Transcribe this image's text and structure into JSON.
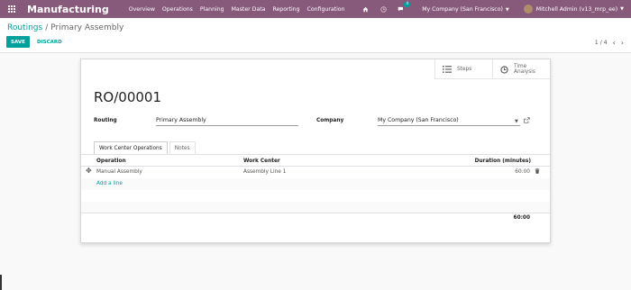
{
  "navbar": {
    "brand": "Manufacturing",
    "menu": [
      "Overview",
      "Operations",
      "Planning",
      "Master Data",
      "Reporting",
      "Configuration"
    ],
    "chat_badge": "4",
    "company": "My Company (San Francisco)",
    "user": "Mitchell Admin (v13_mrp_ee)",
    "accent": "#875a7b"
  },
  "control": {
    "breadcrumb_parent": "Routings",
    "breadcrumb_current": "Primary Assembly",
    "save_label": "SAVE",
    "discard_label": "DISCARD",
    "pager": "1 / 4"
  },
  "sheet": {
    "smart_buttons": {
      "steps": "Steps",
      "time_analysis_1": "Time",
      "time_analysis_2": "Analysis"
    },
    "title": "RO/00001",
    "routing_label": "Routing",
    "routing_value": "Primary Assembly",
    "company_label": "Company",
    "company_value": "My Company (San Francisco)",
    "tabs": [
      "Work Center Operations",
      "Notes"
    ],
    "table": {
      "columns": [
        "Operation",
        "Work Center",
        "Duration (minutes)"
      ],
      "rows": [
        {
          "operation": "Manual Assembly",
          "work_center": "Assembly Line 1",
          "duration": "60:00"
        }
      ],
      "add_line": "Add a line",
      "total": "60:00"
    }
  },
  "colors": {
    "primary": "#00a09d",
    "navbar": "#875a7b"
  }
}
